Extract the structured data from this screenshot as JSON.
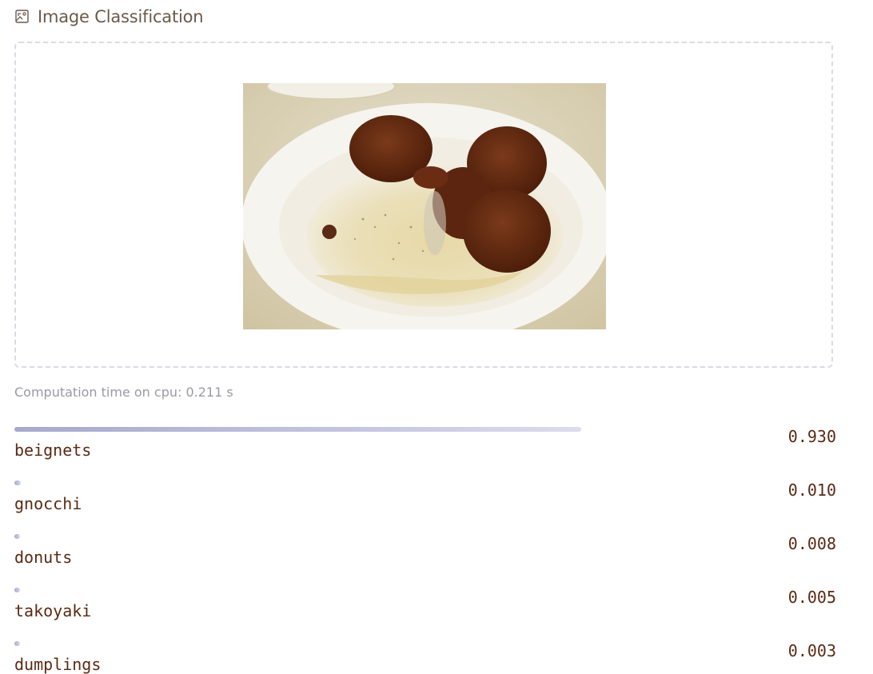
{
  "header": {
    "title": "Image Classification",
    "icon": "image-classify-icon"
  },
  "input": {
    "image_alt": "beignets on a white plate"
  },
  "computation": {
    "text": "Computation time on cpu: 0.211 s"
  },
  "results": [
    {
      "label": "beignets",
      "score": "0.930",
      "confidence": 0.93
    },
    {
      "label": "gnocchi",
      "score": "0.010",
      "confidence": 0.01
    },
    {
      "label": "donuts",
      "score": "0.008",
      "confidence": 0.008
    },
    {
      "label": "takoyaki",
      "score": "0.005",
      "confidence": 0.005
    },
    {
      "label": "dumplings",
      "score": "0.003",
      "confidence": 0.003
    }
  ],
  "colors": {
    "title": "#6b5a4a",
    "label_text": "#5a2a14",
    "muted_text": "#9a9aa2",
    "bar": "#b2b4d6",
    "dropzone_border": "#d9dbe6"
  }
}
